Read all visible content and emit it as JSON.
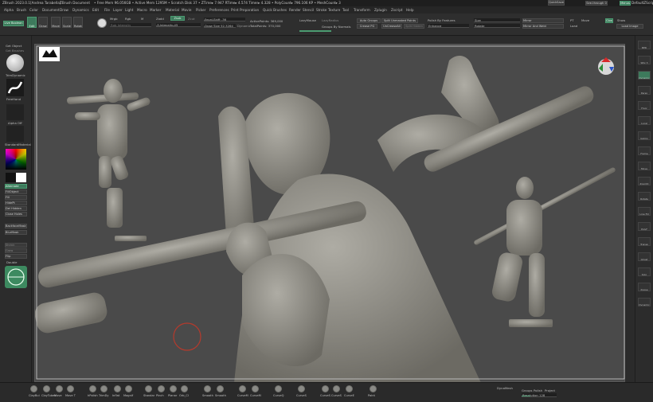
{
  "titlebar": {
    "app": "ZBrush 2023.0.1",
    "doc": "[Andrea Tarabella]",
    "doc_title": "ZBrush Document",
    "stats": "• Free Mem 96.056GB • Active Mem 1295M • Scratch Disk 37 • ZTime▸ 7.947 RTime▸ 4.574 Timer▸ 4.328 • PolyCount▸ 796.106 KP • MeshCount▸ 3",
    "menus_label": "Menus",
    "quicksave": "QuickSave",
    "seethrough": "See-through 0",
    "ui_label": "Menus",
    "default_script": "DefaultZScript"
  },
  "menus": [
    "Alpha",
    "Brush",
    "Color",
    "Document",
    "Draw",
    "Dynamics",
    "Edit",
    "File",
    "Layer",
    "Light",
    "Macro",
    "Marker",
    "Material",
    "Movie",
    "Picker",
    "Preferences",
    "Print Preparation",
    "Quick Brushes",
    "Render",
    "Stencil",
    "Stroke",
    "Texture",
    "Tool",
    "Transform",
    "Zplugin",
    "Zscript",
    "Help"
  ],
  "toolbar": {
    "live_boolean": "Live Boolean",
    "edit": "Edit",
    "draw": "Draw",
    "move": "Move",
    "scale": "Scale",
    "rotate": "Rotate",
    "mrgb": "Mrgb",
    "rgb": "Rgb",
    "m": "M",
    "zadd": "Zadd",
    "zsub": "Zsub",
    "zcut": "Zcut",
    "rgb_intensity": "Rgb Intensity",
    "z_intensity": "Z Intensity 45",
    "focal_shift": "Focal Shift -36",
    "draw_size": "Draw Size 52.3264",
    "dynamic": "Dynamic",
    "active_points": "ActivePoints: 369,000",
    "total_points": "TotalPoints: 370,000",
    "lazymouse": "LazyMouse",
    "lazyradius": "LazyRadius",
    "groups_by_normals": "Groups By Normals",
    "auto_groups": "Auto Groups",
    "crease_pg": "Crease PG",
    "split_unmasked": "Split Unmasked Points",
    "uncrease_all": "UnCreaseAll",
    "split_hidden": "Split Hidden",
    "polish_by_features": "Polish By Features",
    "enhance": "Enhance",
    "size": "Size",
    "rotate2": "Rotate",
    "mirror": "Mirror",
    "mirror_and_weld": "Mirror And Weld",
    "pt": "PT",
    "move2": "Move",
    "load": "Load",
    "close": "Close",
    "show": "Show",
    "load_image": "Load Image"
  },
  "leftpanel": {
    "get_object": "Get Object",
    "get_brush": "Get Brushes",
    "brush_name": "TrimDynamic",
    "stroke_name": "FreeHand",
    "alpha_off": "Alpha Off",
    "texture_off": "Texture Off",
    "material_name": "StandardMaterial",
    "alternate": "Alternate",
    "fill_object": "FillObject",
    "fill": "Fill",
    "hidepts": "HidePt",
    "del_hidden": "Del Hidden",
    "close_holes": "Close Holes",
    "backface_mask": "BackfaceMask",
    "blur_mask": "BlurMask",
    "shrink": "Shrink",
    "grow": "Grow",
    "flip": "Flip",
    "double": "Double"
  },
  "rightpanel": [
    "BPR",
    "SPix 3",
    "Dynamic",
    "Persp",
    "Floor",
    "Local",
    "Gizmo",
    "Frame",
    "Move",
    "ZoomD",
    "Rotate",
    "Line Fill",
    "PolyF",
    "Transp",
    "Ghost",
    "Solo",
    "Xpose",
    "Dynamic"
  ],
  "bottombar": {
    "brushes": [
      "ClayBui",
      "ClayTubes",
      "Move",
      "Move T",
      "hPolish",
      "TrimDy",
      "Inflat",
      "Magnif",
      "Standar",
      "Pinch",
      "Planar",
      "Orb_Cl",
      "Smooth",
      "Smooth",
      "CurveM",
      "CurveM",
      "CurveQ",
      "CurveS",
      "CurveS",
      "CurveS",
      "CurveE",
      "Paint"
    ],
    "dynamesh": "DynaMesh",
    "groups": "Groups",
    "polish": "Polish",
    "project": "Project",
    "resolution": "Resolution 128"
  },
  "colors": {
    "accent": "#3d7a5c",
    "canvas": "#4a4a4a",
    "clay": "#8d8b84"
  }
}
